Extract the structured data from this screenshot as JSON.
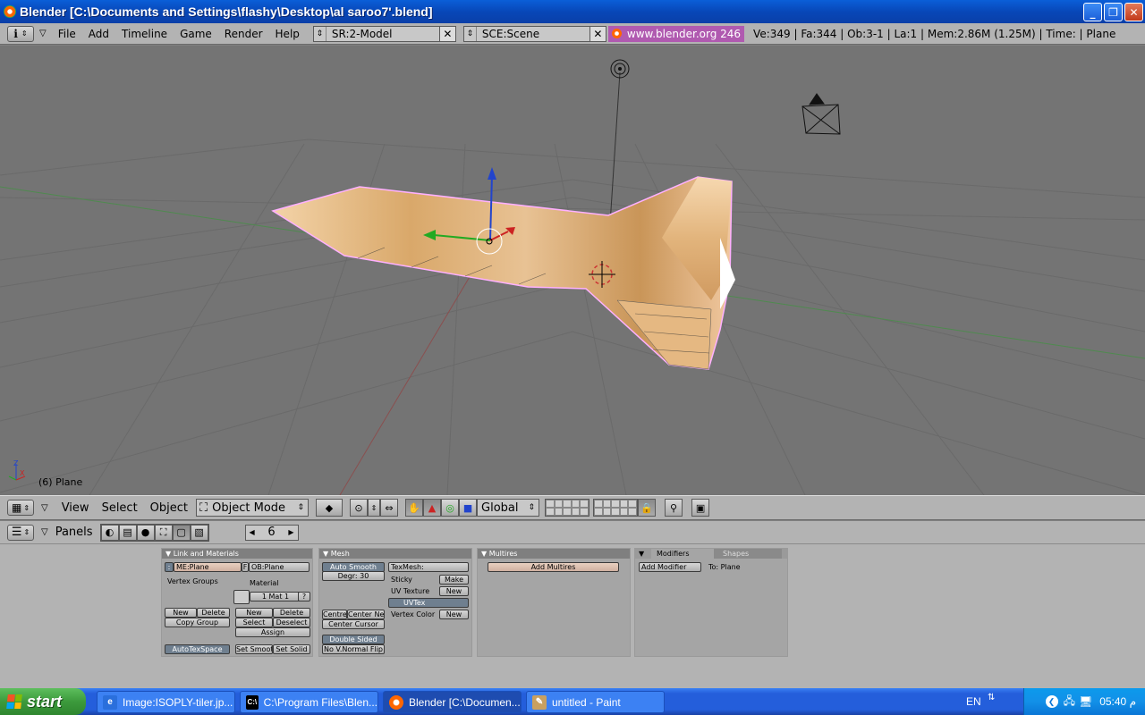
{
  "window": {
    "title": "Blender [C:\\Documents and Settings\\flashy\\Desktop\\al saroo7'.blend]",
    "buttons": {
      "minimize": "_",
      "restore": "❐",
      "close": "✕"
    }
  },
  "topheader": {
    "menus": [
      "File",
      "Add",
      "Timeline",
      "Game",
      "Render",
      "Help"
    ],
    "screen": "SR:2-Model",
    "scene": "SCE:Scene",
    "url": "www.blender.org 246",
    "stats": "Ve:349 | Fa:344 | Ob:3-1 | La:1  | Mem:2.86M (1.25M)  | Time: | Plane"
  },
  "viewport": {
    "object_label": "(6) Plane",
    "axis_labels": {
      "z": "Z",
      "x": "X"
    }
  },
  "viewheader": {
    "menus": [
      "View",
      "Select",
      "Object"
    ],
    "mode": "Object Mode",
    "orientation": "Global"
  },
  "buttons_window": {
    "panels_label": "Panels",
    "frame": "6",
    "link_materials": {
      "title": "Link and Materials",
      "me": "ME:Plane",
      "f": "F",
      "ob": "OB:Plane",
      "vertex_groups": "Vertex Groups",
      "material": "Material",
      "mat_index": "1 Mat 1",
      "mat_q": "?",
      "new": "New",
      "delete": "Delete",
      "copy_group": "Copy Group",
      "select": "Select",
      "deselect": "Deselect",
      "assign": "Assign",
      "autotexspace": "AutoTexSpace",
      "set_smooth": "Set Smoot",
      "set_solid": "Set Solid"
    },
    "mesh": {
      "title": "Mesh",
      "auto_smooth": "Auto Smooth",
      "degr": "Degr: 30",
      "centre": "Centre",
      "center_new": "Center Ne",
      "center_cursor": "Center Cursor",
      "double_sided": "Double Sided",
      "no_vnormal_flip": "No V.Normal Flip",
      "texmesh": "TexMesh:",
      "sticky": "Sticky",
      "make": "Make",
      "uv_texture": "UV Texture",
      "new": "New",
      "uvtex": "UVTex",
      "vertex_color": "Vertex Color",
      "new2": "New"
    },
    "multires": {
      "title": "Multires",
      "add": "Add Multires"
    },
    "modifiers": {
      "tab_modifiers": "Modifiers",
      "tab_shapes": "Shapes",
      "add": "Add Modifier",
      "to": "To: Plane"
    }
  },
  "taskbar": {
    "start": "start",
    "tasks": [
      "Image:ISOPLY-tiler.jp...",
      "C:\\Program Files\\Blen...",
      "Blender [C:\\Documen...",
      "untitled - Paint"
    ],
    "lang": "EN",
    "clock": "05:40 م"
  },
  "colors": {
    "viewport_bg": "#747474",
    "panel_bg": "#b3b3b3",
    "taskbar": "#245edb",
    "titlebar": "#0a5fd8",
    "start_green": "#3c9a3c"
  }
}
